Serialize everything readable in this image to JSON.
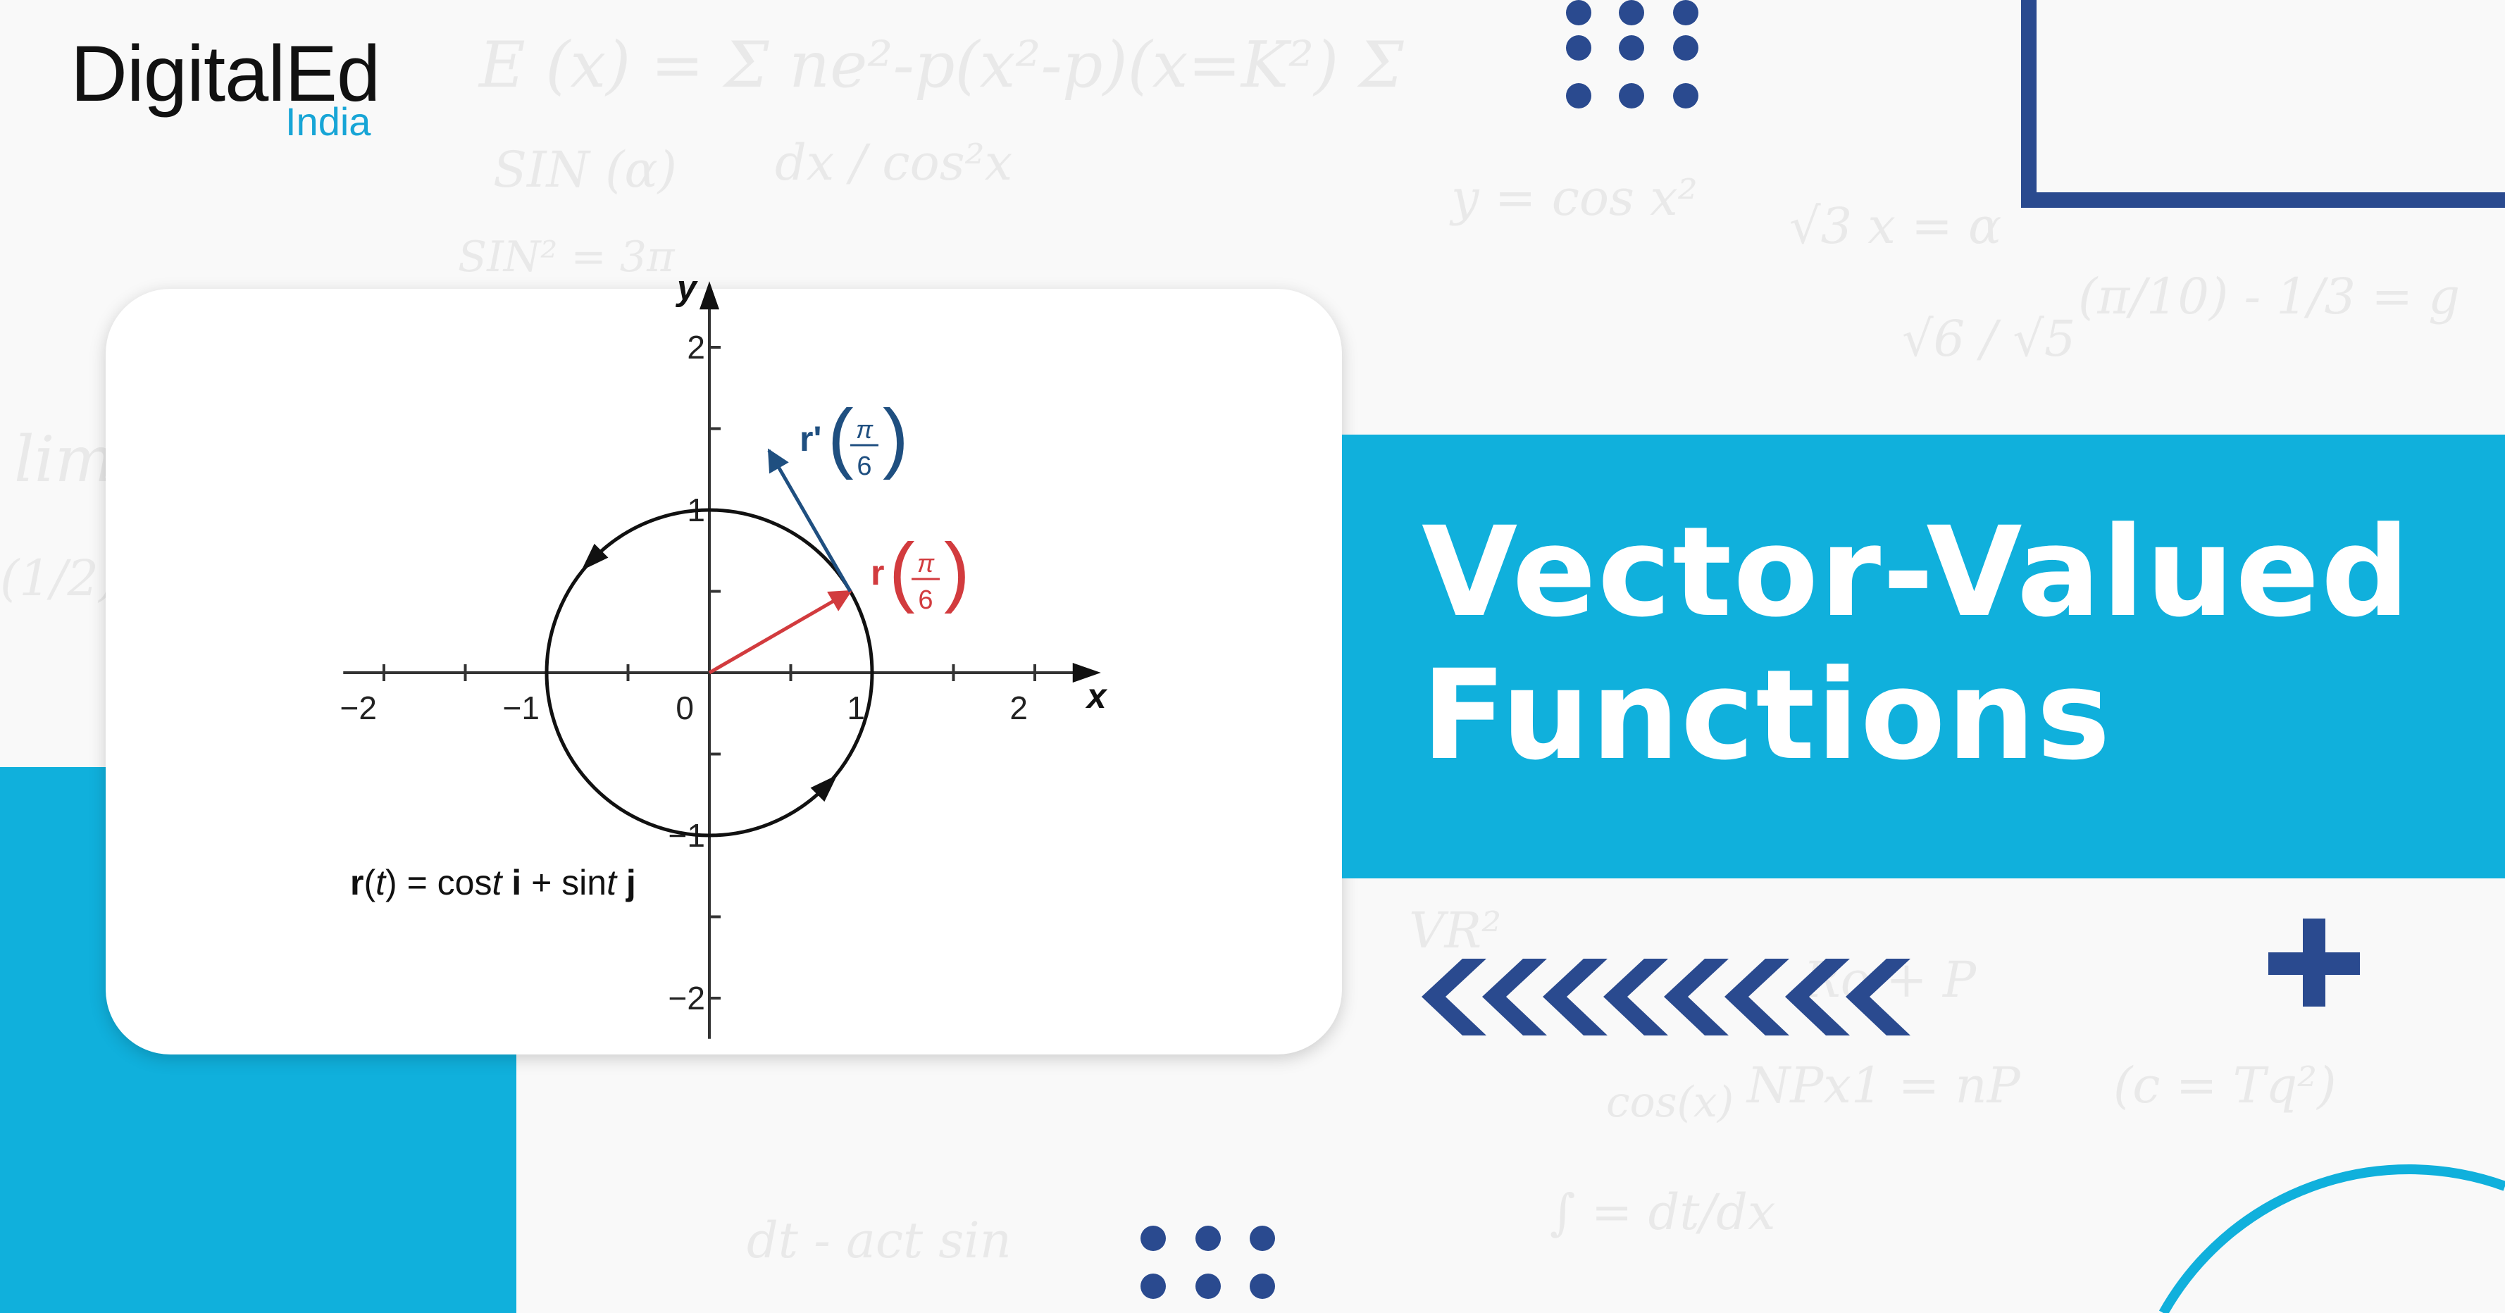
{
  "brand": {
    "name": "DigitalEd",
    "sub": "India",
    "accent": "#10b0dc",
    "navy": "#2a4a8f"
  },
  "title": {
    "line1": "Vector-Valued",
    "line2": "Functions"
  },
  "background_doodles": [
    "E (x) = Σ  ne²-p(x²-p)(x=K²) Σ",
    "SIN (α)",
    "dx / cos²x",
    "y = cos x²",
    "√3  x = α",
    "√6 / √5",
    "(π/10) - 1/3 = g",
    "SIN² = 3π",
    "NPx1 = nP",
    "cos(x)",
    "∫ = dt/dx",
    "dt - act sin",
    "(c = Tq²)",
    "Ro + P",
    "VR²",
    "lim",
    "(1/2)"
  ],
  "figure": {
    "x_axis_label": "x",
    "y_axis_label": "y",
    "x_tick_labels": [
      "−2",
      "−1",
      "0",
      "1",
      "2"
    ],
    "y_tick_labels": [
      "2",
      "1",
      "−1",
      "−2"
    ],
    "x_range": [
      -2.25,
      2.25
    ],
    "y_range": [
      -2.25,
      2.25
    ],
    "curve": "unit circle, counterclockwise",
    "r_label": "r",
    "r_prime_label": "r'",
    "arg_num": "π",
    "arg_den": "6",
    "r_vector": {
      "from": [
        0,
        0
      ],
      "to": [
        0.866,
        0.5
      ],
      "color": "#d23b3e"
    },
    "r_prime_vector": {
      "from": [
        0.866,
        0.5
      ],
      "to": [
        0.366,
        1.366
      ],
      "color": "#1f4f80"
    },
    "formula": {
      "r": "r",
      "t": "t",
      "eq": ") = cos",
      "i": "i",
      "plus": " + sin",
      "j": "j"
    }
  }
}
